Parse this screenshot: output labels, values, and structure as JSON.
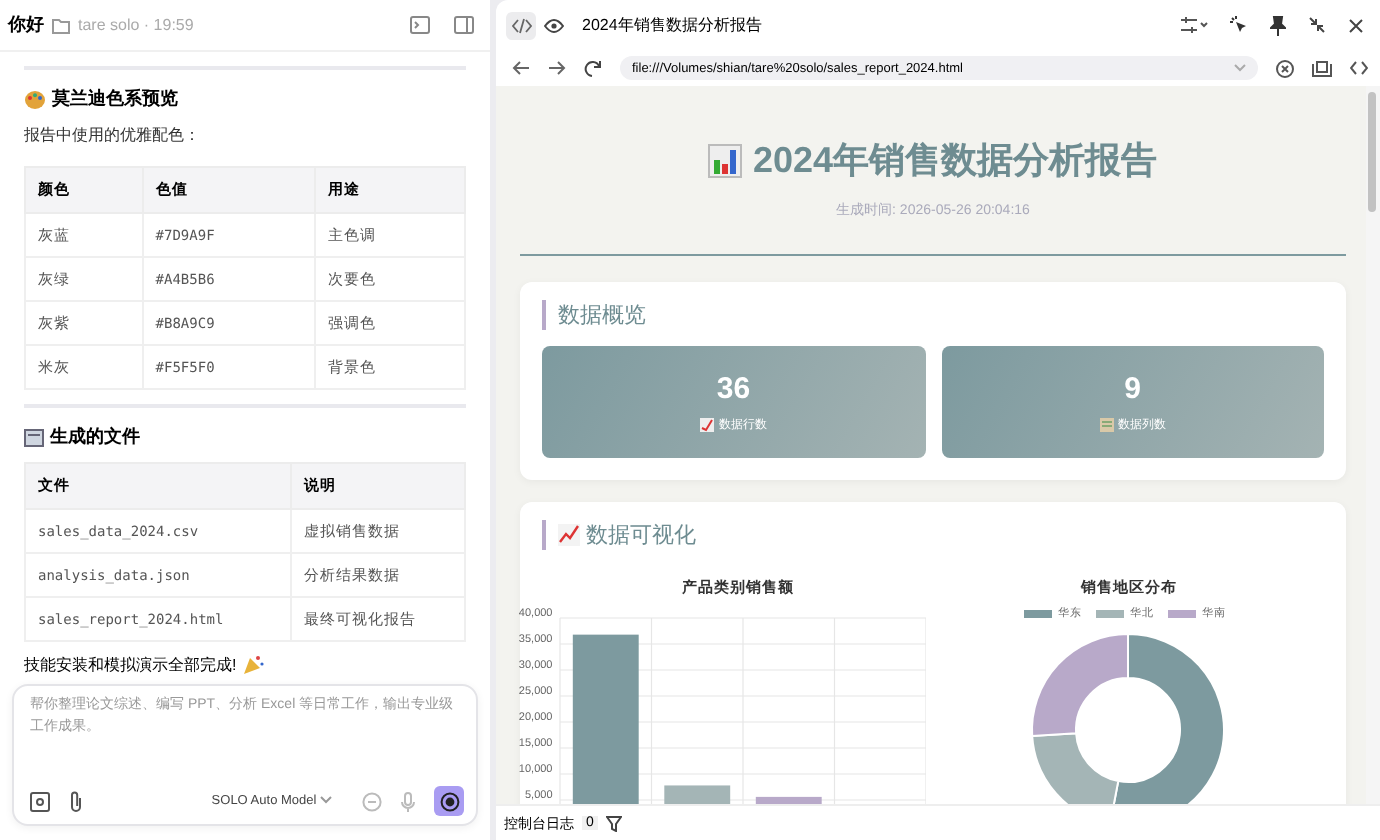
{
  "chat_header": {
    "title": "你好",
    "project": "tare solo · 19:59"
  },
  "palette_section": {
    "heading": "莫兰迪色系预览",
    "intro": "报告中使用的优雅配色：",
    "columns": [
      "颜色",
      "色值",
      "用途"
    ],
    "rows": [
      {
        "name": "灰蓝",
        "hex": "#7D9A9F",
        "usage": "主色调"
      },
      {
        "name": "灰绿",
        "hex": "#A4B5B6",
        "usage": "次要色"
      },
      {
        "name": "灰紫",
        "hex": "#B8A9C9",
        "usage": "强调色"
      },
      {
        "name": "米灰",
        "hex": "#F5F5F0",
        "usage": "背景色"
      }
    ]
  },
  "files_section": {
    "heading": "生成的文件",
    "columns": [
      "文件",
      "说明"
    ],
    "rows": [
      {
        "file": "sales_data_2024.csv",
        "note": "虚拟销售数据"
      },
      {
        "file": "analysis_data.json",
        "note": "分析结果数据"
      },
      {
        "file": "sales_report_2024.html",
        "note": "最终可视化报告"
      }
    ]
  },
  "completion_message": "技能安装和模拟演示全部完成!",
  "composer": {
    "placeholder": "帮你整理论文综述、编写 PPT、分析 Excel 等日常工作，输出专业级工作成果。",
    "model": "SOLO Auto Model"
  },
  "preview": {
    "view_tabs": [
      {
        "kind": "code",
        "selected": true
      },
      {
        "kind": "preview",
        "selected": false
      }
    ],
    "title": "2024年销售数据分析报告",
    "url": "file:///Volumes/shian/tare%20solo/sales_report_2024.html"
  },
  "report": {
    "title": "2024年销售数据分析报告",
    "generated": "生成时间: 2026-05-26 20:04:16",
    "overview": {
      "heading": "数据概览",
      "stats": [
        {
          "value": "36",
          "label": "数据行数"
        },
        {
          "value": "9",
          "label": "数据列数"
        }
      ]
    },
    "visualization": {
      "heading": "数据可视化",
      "bar_chart": {
        "chart_data": {
          "type": "bar",
          "title": "产品类别销售额",
          "grid": true,
          "series": [
            {
              "color": "#7d9a9f",
              "values": [
                36800,
                null,
                null,
                null
              ]
            },
            {
              "color": "#a4b5b6",
              "values": [
                null,
                7800,
                null,
                null
              ]
            },
            {
              "color": "#b8a9c9",
              "values": [
                null,
                null,
                5600,
                null
              ]
            }
          ],
          "ylim": [
            0,
            40000
          ],
          "yticks": [
            {
              "value": 5000,
              "label": "5,000"
            },
            {
              "value": 10000,
              "label": "10,000"
            },
            {
              "value": 15000,
              "label": "15,000"
            },
            {
              "value": 20000,
              "label": "20,000"
            },
            {
              "value": 25000,
              "label": "25,000"
            },
            {
              "value": 30000,
              "label": "30,000"
            },
            {
              "value": 35000,
              "label": "35,000"
            },
            {
              "value": 40000,
              "label": "40,000"
            }
          ]
        }
      },
      "donut_chart": {
        "title": "销售地区分布",
        "legend": [
          {
            "label": "华东",
            "color": "#7d9a9f"
          },
          {
            "label": "华北",
            "color": "#a4b5b6"
          },
          {
            "label": "华南",
            "color": "#b8a9c9"
          }
        ]
      }
    }
  },
  "console": {
    "label": "控制台日志",
    "count": "0"
  }
}
